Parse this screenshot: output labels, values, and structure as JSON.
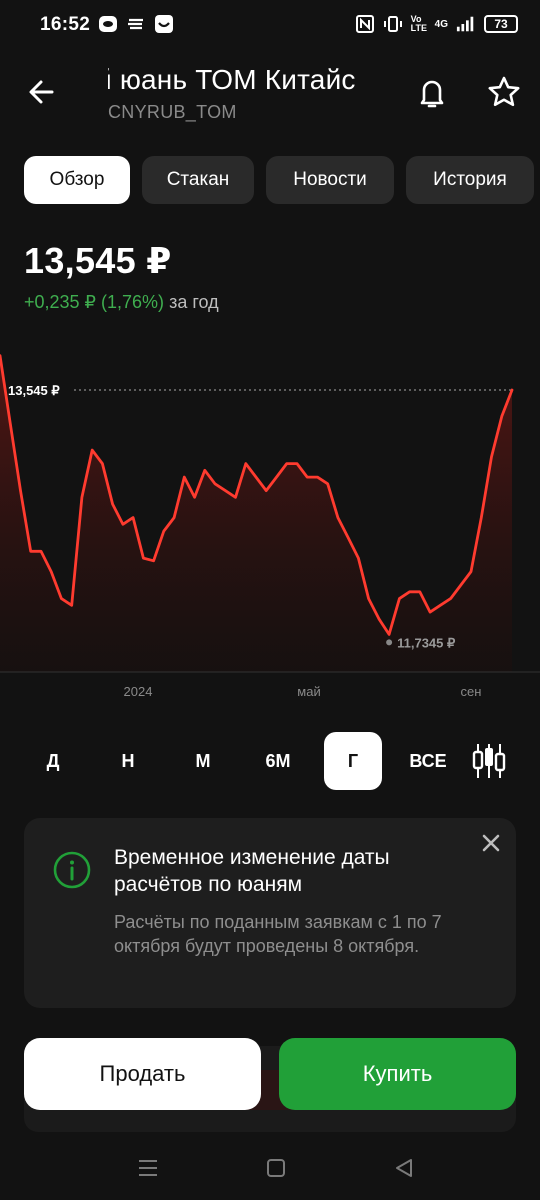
{
  "status_bar": {
    "time": "16:52",
    "battery": "73",
    "volte": "Vo LTE",
    "network": "4G"
  },
  "header": {
    "title": "й юань ТОМ Китайс",
    "ticker": "CNYRUB_TOM"
  },
  "tabs": [
    {
      "label": "Обзор",
      "active": true
    },
    {
      "label": "Стакан",
      "active": false
    },
    {
      "label": "Новости",
      "active": false
    },
    {
      "label": "История",
      "active": false
    }
  ],
  "quote": {
    "price": "13,545 ₽",
    "change": "+0,235 ₽ (1,76%)",
    "period_text": "за год"
  },
  "chart_data": {
    "type": "area",
    "last_label": "13,545 ₽",
    "min_label": "11,7345 ₽",
    "x_ticks": [
      "2024",
      "май",
      "сен"
    ],
    "values": [
      13.8,
      13.3,
      12.8,
      12.35,
      12.35,
      12.2,
      12.0,
      11.95,
      12.75,
      13.1,
      13.0,
      12.7,
      12.55,
      12.6,
      12.3,
      12.28,
      12.5,
      12.6,
      12.9,
      12.75,
      12.95,
      12.85,
      12.8,
      12.75,
      13.0,
      12.9,
      12.8,
      12.9,
      13.0,
      13.0,
      12.9,
      12.9,
      12.85,
      12.6,
      12.45,
      12.3,
      12.0,
      11.85,
      11.7345,
      12.0,
      12.05,
      12.05,
      11.9,
      11.95,
      12.0,
      12.1,
      12.2,
      12.6,
      13.05,
      13.35,
      13.545
    ],
    "color": "#ff3b2f"
  },
  "periods": [
    {
      "label": "Д",
      "active": false
    },
    {
      "label": "Н",
      "active": false
    },
    {
      "label": "М",
      "active": false
    },
    {
      "label": "6М",
      "active": false
    },
    {
      "label": "Г",
      "active": true
    },
    {
      "label": "ВСЕ",
      "active": false
    }
  ],
  "notice": {
    "title": "Временное изменение даты расчётов по юаням",
    "body": "Расчёты по поданным заявкам с 1 по 7 октября будут проведены 8 октября."
  },
  "actions": {
    "sell": "Продать",
    "buy": "Купить"
  },
  "colors": {
    "accent_green": "#21a038",
    "positive": "#3fae4f",
    "chart_line": "#ff3b2f"
  }
}
